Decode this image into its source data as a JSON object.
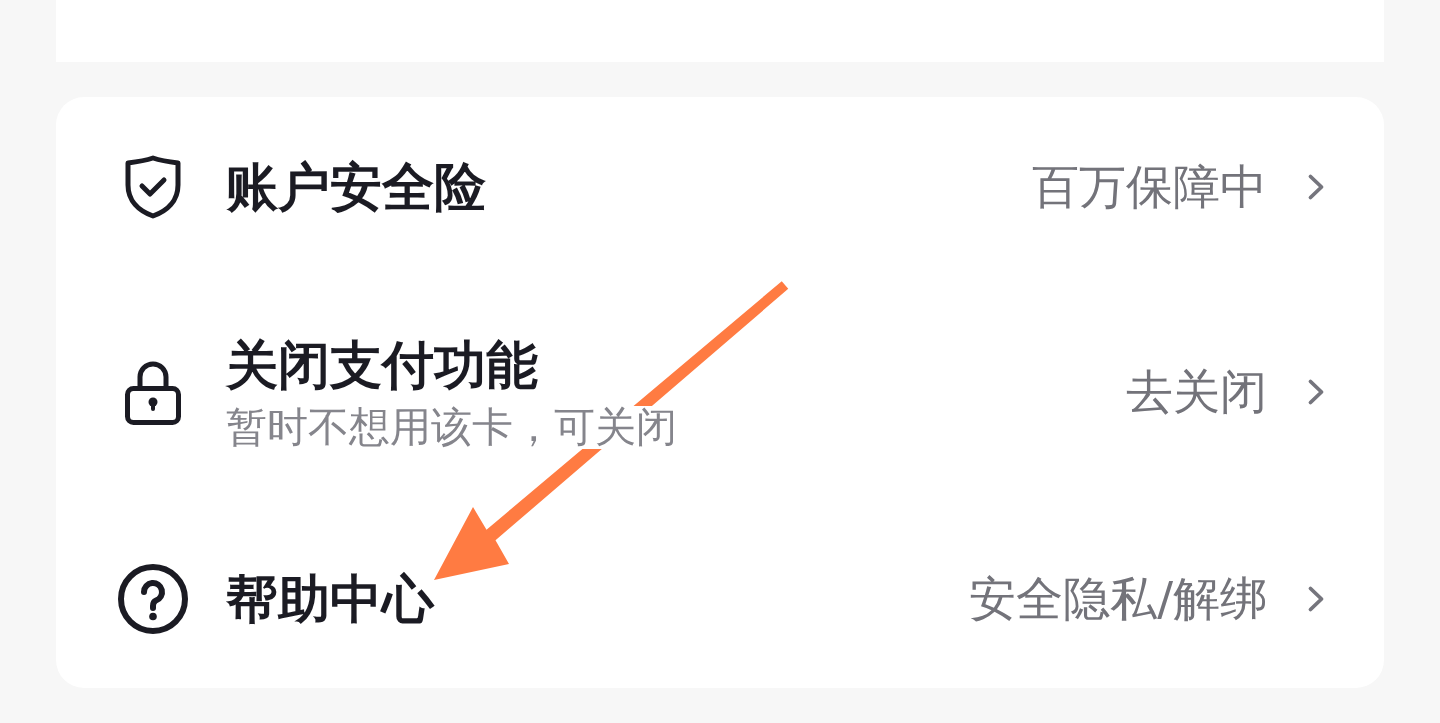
{
  "menu": {
    "items": [
      {
        "kind": "shield",
        "title": "账户安全险",
        "status": "百万保障中"
      },
      {
        "kind": "lock",
        "title": "关闭支付功能",
        "subtitle": "暂时不想用该卡，可关闭",
        "status": "去关闭"
      },
      {
        "kind": "question",
        "title": "帮助中心",
        "status": "安全隐私/解绑"
      }
    ]
  }
}
